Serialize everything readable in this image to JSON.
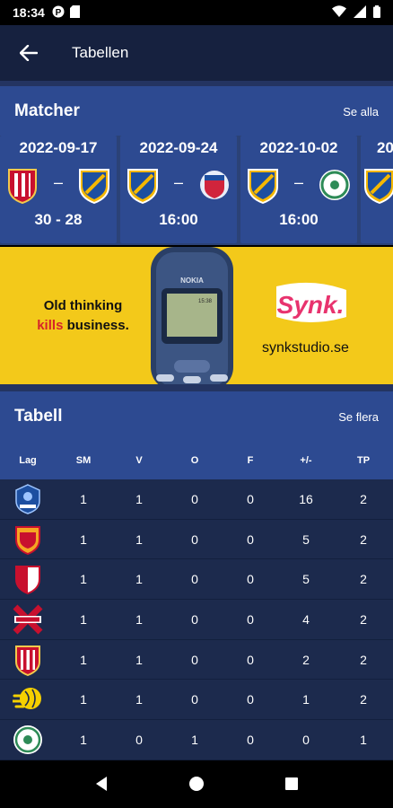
{
  "status": {
    "time": "18:34"
  },
  "appbar": {
    "title": "Tabellen"
  },
  "matches": {
    "title": "Matcher",
    "see_all": "Se alla",
    "items": [
      {
        "date": "2022-09-17",
        "result": "30 - 28",
        "home": "red-white-crest",
        "away": "blue-gold-crest"
      },
      {
        "date": "2022-09-24",
        "result": "16:00",
        "home": "blue-gold-crest",
        "away": "blue-red-crest"
      },
      {
        "date": "2022-10-02",
        "result": "16:00",
        "home": "blue-gold-crest",
        "away": "green-white-crest"
      },
      {
        "date": "20",
        "result": "",
        "home": "blue-gold-crest",
        "away": ""
      }
    ]
  },
  "ad": {
    "slogan_line1": "Old thinking",
    "slogan_red": "kills",
    "slogan_rest": "business.",
    "brand": "Synk.",
    "site": "synkstudio.se",
    "phone_brand": "NOKIA",
    "phone_time": "15:38"
  },
  "table": {
    "title": "Tabell",
    "see_more": "Se flera",
    "columns": [
      "Lag",
      "SM",
      "V",
      "O",
      "F",
      "+/-",
      "TP"
    ],
    "rows": [
      {
        "logo": "blue-shield-crest",
        "sm": "1",
        "v": "1",
        "o": "0",
        "f": "0",
        "diff": "16",
        "tp": "2"
      },
      {
        "logo": "red-orange-crest",
        "sm": "1",
        "v": "1",
        "o": "0",
        "f": "0",
        "diff": "5",
        "tp": "2"
      },
      {
        "logo": "red-white-shield-crest",
        "sm": "1",
        "v": "1",
        "o": "0",
        "f": "0",
        "diff": "5",
        "tp": "2"
      },
      {
        "logo": "red-x-crest",
        "sm": "1",
        "v": "1",
        "o": "0",
        "f": "0",
        "diff": "4",
        "tp": "2"
      },
      {
        "logo": "red-white-crest",
        "sm": "1",
        "v": "1",
        "o": "0",
        "f": "0",
        "diff": "2",
        "tp": "2"
      },
      {
        "logo": "yellow-ball-crest",
        "sm": "1",
        "v": "1",
        "o": "0",
        "f": "0",
        "diff": "1",
        "tp": "2"
      },
      {
        "logo": "green-white-crest",
        "sm": "1",
        "v": "0",
        "o": "1",
        "f": "0",
        "diff": "0",
        "tp": "1"
      }
    ]
  },
  "colors": {
    "header_bg": "#16213f",
    "section_bg": "#2d4a91",
    "row_bg": "#1c2a4d",
    "ad_bg": "#f3c91a"
  }
}
